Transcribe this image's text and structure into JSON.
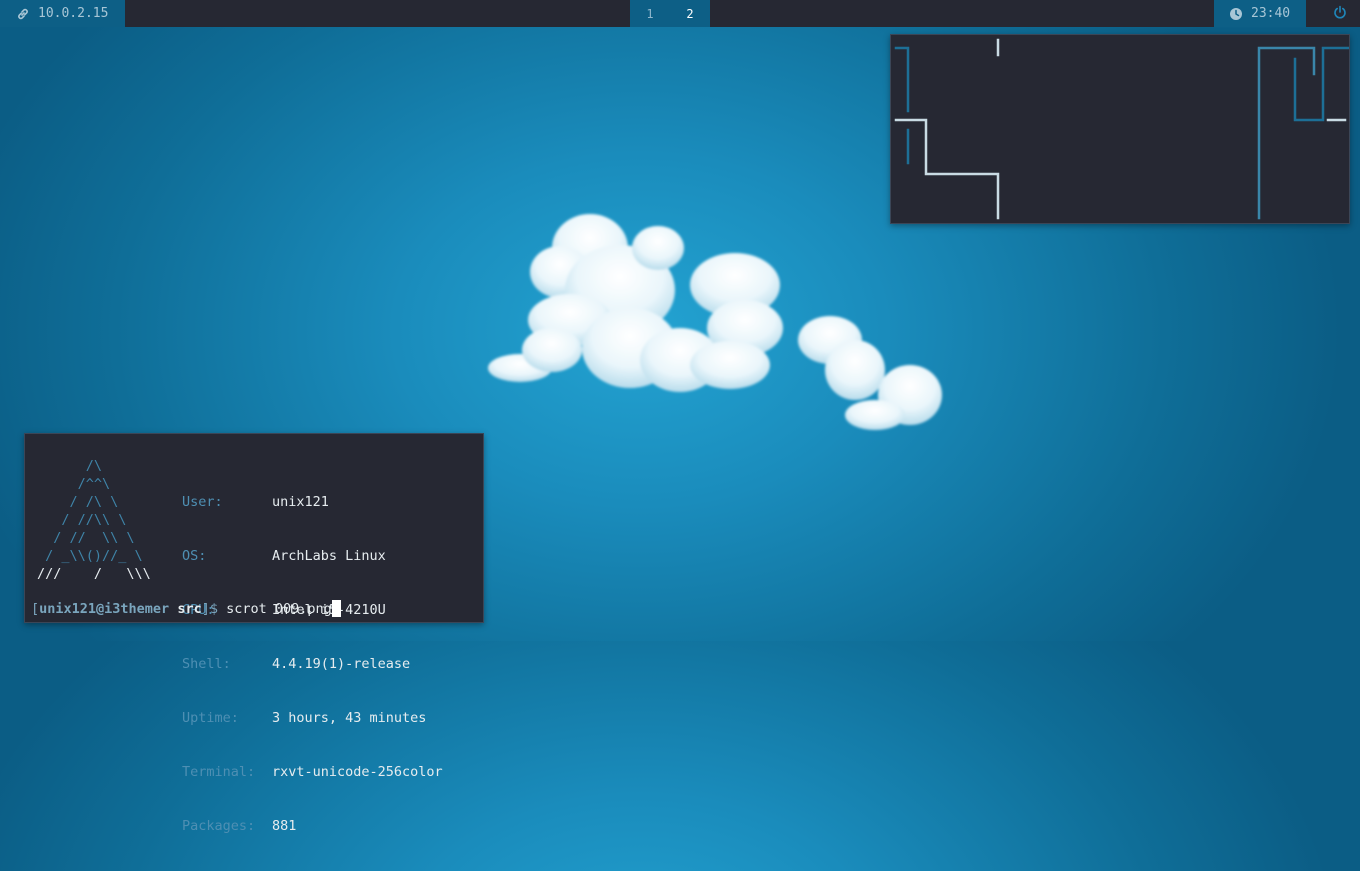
{
  "topbar": {
    "network": {
      "icon": "link-icon",
      "address": "10.0.2.15"
    },
    "workspaces": [
      {
        "label": "1",
        "active": false
      },
      {
        "label": "2",
        "active": true
      }
    ],
    "clock": {
      "icon": "clock-icon",
      "time": "23:40"
    },
    "power": {
      "icon": "power-icon"
    }
  },
  "colors": {
    "bar_dark": "#262833",
    "bar_accent": "#0d5f86",
    "desktop_blue": "#1a8cbc",
    "terminal_bg": "#262833",
    "label_blue": "#4e8fb3"
  },
  "terminal": {
    "logo_lines": [
      "      /\\",
      "     /^^\\",
      "    / /\\ \\",
      "   / //\\\\ \\",
      "  / //  \\\\ \\",
      " / _\\\\()//_ \\",
      "///    /   \\\\\\"
    ],
    "info": [
      {
        "key": "User:",
        "value": "unix121"
      },
      {
        "key": "OS:",
        "value": "ArchLabs Linux"
      },
      {
        "key": "CPU:",
        "value": "Intel i5-4210U"
      },
      {
        "key": "Shell:",
        "value": "4.4.19(1)-release"
      },
      {
        "key": "Uptime:",
        "value": "3 hours, 43 minutes"
      },
      {
        "key": "Terminal:",
        "value": "rxvt-unicode-256color"
      },
      {
        "key": "Packages:",
        "value": "881"
      }
    ],
    "prompt": {
      "open": "[",
      "user_host": "unix121@i3themer",
      "dir": "src",
      "close": "]$",
      "command": "scrot 009.png"
    }
  },
  "wallpaper": {
    "subject": "cloud-image"
  }
}
